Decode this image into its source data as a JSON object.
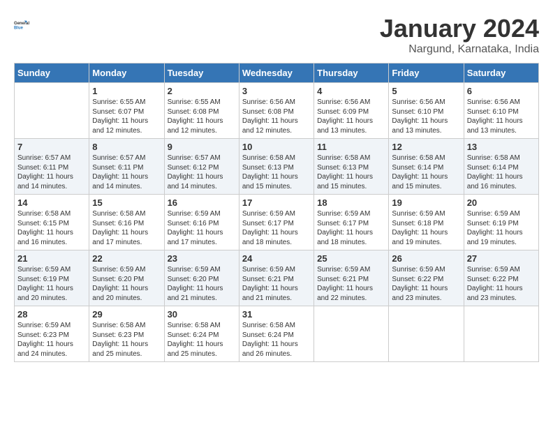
{
  "header": {
    "logo_line1": "General",
    "logo_line2": "Blue",
    "title": "January 2024",
    "subtitle": "Nargund, Karnataka, India"
  },
  "days_of_week": [
    "Sunday",
    "Monday",
    "Tuesday",
    "Wednesday",
    "Thursday",
    "Friday",
    "Saturday"
  ],
  "weeks": [
    [
      {
        "num": "",
        "empty": true
      },
      {
        "num": "1",
        "sunrise": "6:55 AM",
        "sunset": "6:07 PM",
        "daylight": "11 hours and 12 minutes."
      },
      {
        "num": "2",
        "sunrise": "6:55 AM",
        "sunset": "6:08 PM",
        "daylight": "11 hours and 12 minutes."
      },
      {
        "num": "3",
        "sunrise": "6:56 AM",
        "sunset": "6:08 PM",
        "daylight": "11 hours and 12 minutes."
      },
      {
        "num": "4",
        "sunrise": "6:56 AM",
        "sunset": "6:09 PM",
        "daylight": "11 hours and 13 minutes."
      },
      {
        "num": "5",
        "sunrise": "6:56 AM",
        "sunset": "6:10 PM",
        "daylight": "11 hours and 13 minutes."
      },
      {
        "num": "6",
        "sunrise": "6:56 AM",
        "sunset": "6:10 PM",
        "daylight": "11 hours and 13 minutes."
      }
    ],
    [
      {
        "num": "7",
        "sunrise": "6:57 AM",
        "sunset": "6:11 PM",
        "daylight": "11 hours and 14 minutes."
      },
      {
        "num": "8",
        "sunrise": "6:57 AM",
        "sunset": "6:11 PM",
        "daylight": "11 hours and 14 minutes."
      },
      {
        "num": "9",
        "sunrise": "6:57 AM",
        "sunset": "6:12 PM",
        "daylight": "11 hours and 14 minutes."
      },
      {
        "num": "10",
        "sunrise": "6:58 AM",
        "sunset": "6:13 PM",
        "daylight": "11 hours and 15 minutes."
      },
      {
        "num": "11",
        "sunrise": "6:58 AM",
        "sunset": "6:13 PM",
        "daylight": "11 hours and 15 minutes."
      },
      {
        "num": "12",
        "sunrise": "6:58 AM",
        "sunset": "6:14 PM",
        "daylight": "11 hours and 15 minutes."
      },
      {
        "num": "13",
        "sunrise": "6:58 AM",
        "sunset": "6:14 PM",
        "daylight": "11 hours and 16 minutes."
      }
    ],
    [
      {
        "num": "14",
        "sunrise": "6:58 AM",
        "sunset": "6:15 PM",
        "daylight": "11 hours and 16 minutes."
      },
      {
        "num": "15",
        "sunrise": "6:58 AM",
        "sunset": "6:16 PM",
        "daylight": "11 hours and 17 minutes."
      },
      {
        "num": "16",
        "sunrise": "6:59 AM",
        "sunset": "6:16 PM",
        "daylight": "11 hours and 17 minutes."
      },
      {
        "num": "17",
        "sunrise": "6:59 AM",
        "sunset": "6:17 PM",
        "daylight": "11 hours and 18 minutes."
      },
      {
        "num": "18",
        "sunrise": "6:59 AM",
        "sunset": "6:17 PM",
        "daylight": "11 hours and 18 minutes."
      },
      {
        "num": "19",
        "sunrise": "6:59 AM",
        "sunset": "6:18 PM",
        "daylight": "11 hours and 19 minutes."
      },
      {
        "num": "20",
        "sunrise": "6:59 AM",
        "sunset": "6:19 PM",
        "daylight": "11 hours and 19 minutes."
      }
    ],
    [
      {
        "num": "21",
        "sunrise": "6:59 AM",
        "sunset": "6:19 PM",
        "daylight": "11 hours and 20 minutes."
      },
      {
        "num": "22",
        "sunrise": "6:59 AM",
        "sunset": "6:20 PM",
        "daylight": "11 hours and 20 minutes."
      },
      {
        "num": "23",
        "sunrise": "6:59 AM",
        "sunset": "6:20 PM",
        "daylight": "11 hours and 21 minutes."
      },
      {
        "num": "24",
        "sunrise": "6:59 AM",
        "sunset": "6:21 PM",
        "daylight": "11 hours and 21 minutes."
      },
      {
        "num": "25",
        "sunrise": "6:59 AM",
        "sunset": "6:21 PM",
        "daylight": "11 hours and 22 minutes."
      },
      {
        "num": "26",
        "sunrise": "6:59 AM",
        "sunset": "6:22 PM",
        "daylight": "11 hours and 23 minutes."
      },
      {
        "num": "27",
        "sunrise": "6:59 AM",
        "sunset": "6:22 PM",
        "daylight": "11 hours and 23 minutes."
      }
    ],
    [
      {
        "num": "28",
        "sunrise": "6:59 AM",
        "sunset": "6:23 PM",
        "daylight": "11 hours and 24 minutes."
      },
      {
        "num": "29",
        "sunrise": "6:58 AM",
        "sunset": "6:23 PM",
        "daylight": "11 hours and 25 minutes."
      },
      {
        "num": "30",
        "sunrise": "6:58 AM",
        "sunset": "6:24 PM",
        "daylight": "11 hours and 25 minutes."
      },
      {
        "num": "31",
        "sunrise": "6:58 AM",
        "sunset": "6:24 PM",
        "daylight": "11 hours and 26 minutes."
      },
      {
        "num": "",
        "empty": true
      },
      {
        "num": "",
        "empty": true
      },
      {
        "num": "",
        "empty": true
      }
    ]
  ],
  "labels": {
    "sunrise": "Sunrise:",
    "sunset": "Sunset:",
    "daylight": "Daylight:"
  }
}
